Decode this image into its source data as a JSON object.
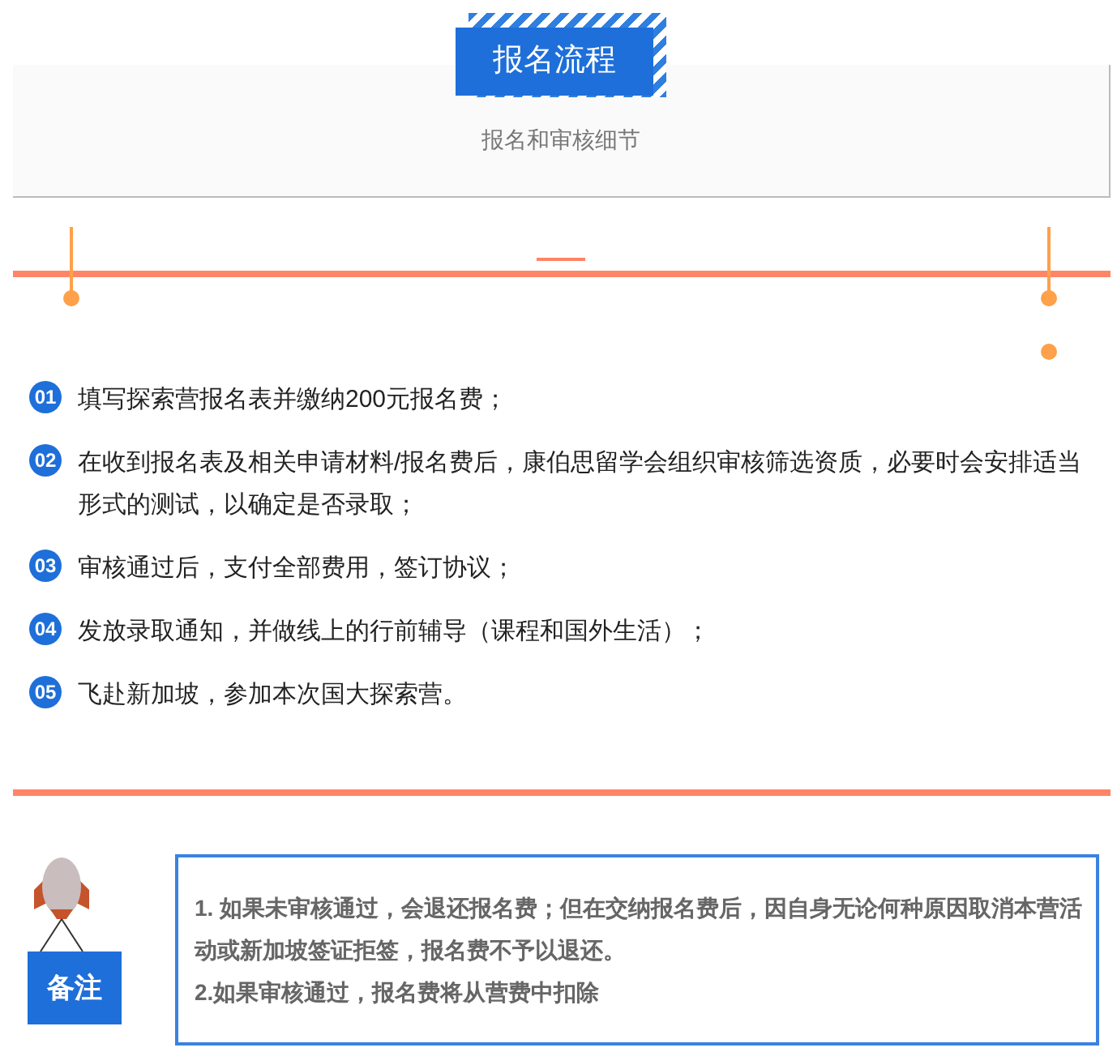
{
  "header": {
    "title": "报名流程",
    "subtitle": "报名和审核细节"
  },
  "steps": [
    {
      "number": "01",
      "text": "填写探索营报名表并缴纳200元报名费；"
    },
    {
      "number": "02",
      "text": "在收到报名表及相关申请材料/报名费后，康伯思留学会组织审核筛选资质，必要时会安排适当形式的测试，以确定是否录取；"
    },
    {
      "number": "03",
      "text": "审核通过后，支付全部费用，签订协议；"
    },
    {
      "number": "04",
      "text": "发放录取通知，并做线上的行前辅导（课程和国外生活）；"
    },
    {
      "number": "05",
      "text": "飞赴新加坡，参加本次国大探索营。"
    }
  ],
  "note": {
    "label": "备注",
    "lines": [
      "1. 如果未审核通过，会退还报名费；但在交纳报名费后，因自身无论何种原因取消本营活动或新加坡签证拒签，报名费不予以退还。",
      "2.如果审核通过，报名费将从营费中扣除"
    ]
  }
}
